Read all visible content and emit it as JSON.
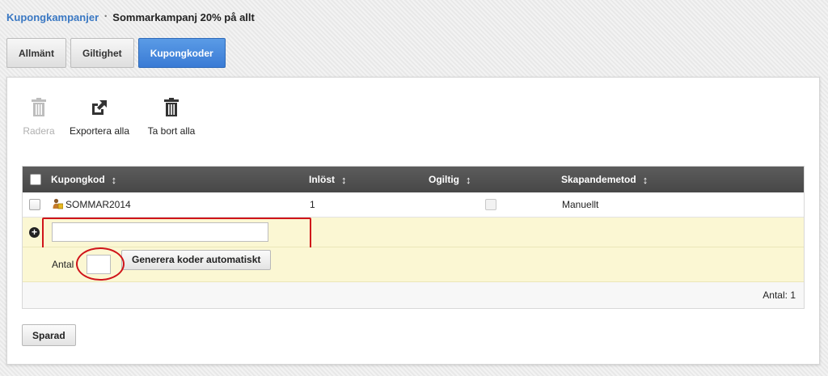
{
  "breadcrumb": {
    "parent": "Kupongkampanjer",
    "separator": "•",
    "current": "Sommarkampanj 20% på allt"
  },
  "tabs": {
    "general": "Allmänt",
    "validity": "Giltighet",
    "codes": "Kupongkoder",
    "active": "Kupongkoder"
  },
  "toolbar": {
    "delete": "Radera",
    "export_all": "Exportera alla",
    "remove_all": "Ta bort alla"
  },
  "grid": {
    "columns": {
      "code": "Kupongkod",
      "redeemed": "Inlöst",
      "invalid": "Ogiltig",
      "method": "Skapandemetod"
    },
    "rows": [
      {
        "code": "SOMMAR2014",
        "redeemed": "1",
        "invalid": false,
        "method": "Manuellt"
      }
    ],
    "new_code": {
      "value": "",
      "placeholder": ""
    },
    "generate": {
      "quantity_label": "Antal",
      "quantity_value": "",
      "button": "Generera koder automatiskt"
    },
    "total": "Antal: 1"
  },
  "save_button": "Sparad",
  "colors": {
    "link": "#3a78c3",
    "active_tab": "#3a7bd5",
    "grid_header": "#4f4f4f",
    "highlight_row": "#fbf7d3",
    "annotation": "#d0141a"
  },
  "icons": {
    "delete": "trash-icon",
    "export": "export-icon",
    "remove_all": "trash-icon",
    "sort": "sort-icon",
    "add": "plus-circle-icon",
    "coupon": "coupon-user-icon"
  }
}
